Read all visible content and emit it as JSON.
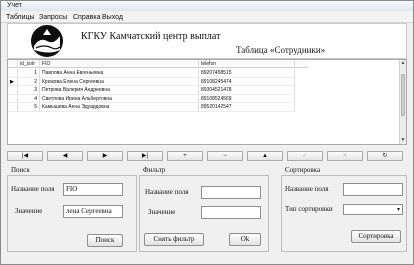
{
  "window": {
    "title": "Учет"
  },
  "menu": {
    "items": [
      "Таблицы",
      "Запросы",
      "Справка",
      "Выход"
    ]
  },
  "header": {
    "org_title": "КГКУ Камчатский центр выплат",
    "table_title": "Таблица «Сотрудники»"
  },
  "grid": {
    "columns": [
      "id_sotr",
      "FIO",
      "telefon"
    ],
    "rows": [
      {
        "id": "1",
        "fio": "Павлова Анна Евгеньевна",
        "tel": "89207458515",
        "current": false
      },
      {
        "id": "2",
        "fio": "Крюкова Елена Сергеевна",
        "tel": "89108245474",
        "current": true
      },
      {
        "id": "3",
        "fio": "Петрова Валерия Андреевна",
        "tel": "89304521478",
        "current": false
      },
      {
        "id": "4",
        "fio": "Светлова Ирина Альбертовна",
        "tel": "89108524569",
        "current": false
      },
      {
        "id": "5",
        "fio": "Камышева Анна Эдуардовна",
        "tel": "89520142547",
        "current": false
      }
    ],
    "current_indicator": "▶"
  },
  "navigator": {
    "buttons": [
      {
        "name": "nav-first-button",
        "glyph": "|◀",
        "enabled": true
      },
      {
        "name": "nav-prior-button",
        "glyph": "◀",
        "enabled": true
      },
      {
        "name": "nav-next-button",
        "glyph": "▶",
        "enabled": true
      },
      {
        "name": "nav-last-button",
        "glyph": "▶|",
        "enabled": true
      },
      {
        "name": "nav-insert-button",
        "glyph": "+",
        "enabled": true
      },
      {
        "name": "nav-delete-button",
        "glyph": "−",
        "enabled": true
      },
      {
        "name": "nav-edit-button",
        "glyph": "▲",
        "enabled": true
      },
      {
        "name": "nav-post-button",
        "glyph": "✓",
        "enabled": false
      },
      {
        "name": "nav-cancel-button",
        "glyph": "✕",
        "enabled": false
      },
      {
        "name": "nav-refresh-button",
        "glyph": "↻",
        "enabled": true
      }
    ]
  },
  "search": {
    "title": "Поиск",
    "field_label": "Название поля",
    "field_value": "FIO",
    "value_label": "Значение",
    "value_value": "лена Сергеевна",
    "button": "Поиск"
  },
  "filter": {
    "title": "Фильтр",
    "field_label": "Название поля",
    "field_value": "",
    "value_label": "Значение",
    "value_value": "",
    "remove_button": "Снять фильтр",
    "ok_button": "Ok"
  },
  "sort": {
    "title": "Сортировка",
    "field_label": "Название поля",
    "field_value": "",
    "type_label": "Тип сортировки",
    "type_value": "",
    "button": "Сортировка"
  }
}
